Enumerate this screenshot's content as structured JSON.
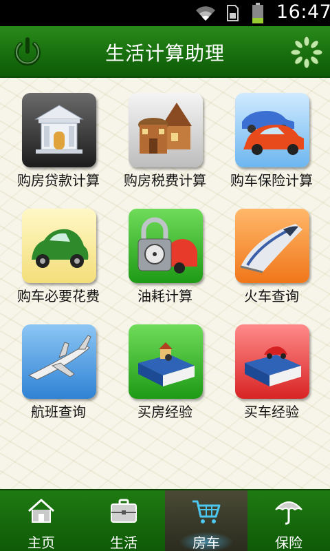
{
  "status_bar": {
    "time": "16:47",
    "icons": [
      "wifi-icon",
      "sim-icon",
      "battery-icon"
    ]
  },
  "header": {
    "title": "生活计算助理",
    "left_icon": "power-icon",
    "right_icon": "loading-icon"
  },
  "tiles": [
    {
      "label": "购房贷款计算",
      "icon": "bank-icon"
    },
    {
      "label": "购房税费计算",
      "icon": "houses-icon"
    },
    {
      "label": "购车保险计算",
      "icon": "cars-icon"
    },
    {
      "label": "购车必要花费",
      "icon": "beetle-car-icon"
    },
    {
      "label": "油耗计算",
      "icon": "lock-car-icon"
    },
    {
      "label": "火车查询",
      "icon": "train-icon"
    },
    {
      "label": "航班查询",
      "icon": "airplane-icon"
    },
    {
      "label": "买房经验",
      "icon": "house-book-icon"
    },
    {
      "label": "买车经验",
      "icon": "car-book-icon"
    }
  ],
  "bottom_nav": [
    {
      "label": "主页",
      "icon": "home-icon",
      "active": false
    },
    {
      "label": "生活",
      "icon": "briefcase-icon",
      "active": false
    },
    {
      "label": "房车",
      "icon": "cart-icon",
      "active": true
    },
    {
      "label": "保险",
      "icon": "umbrella-icon",
      "active": false
    }
  ],
  "colors": {
    "header_green": "#1b7410",
    "nav_green": "#1f7a12",
    "active_tab": "#3a3a2a",
    "background": "#f7f5ea"
  }
}
